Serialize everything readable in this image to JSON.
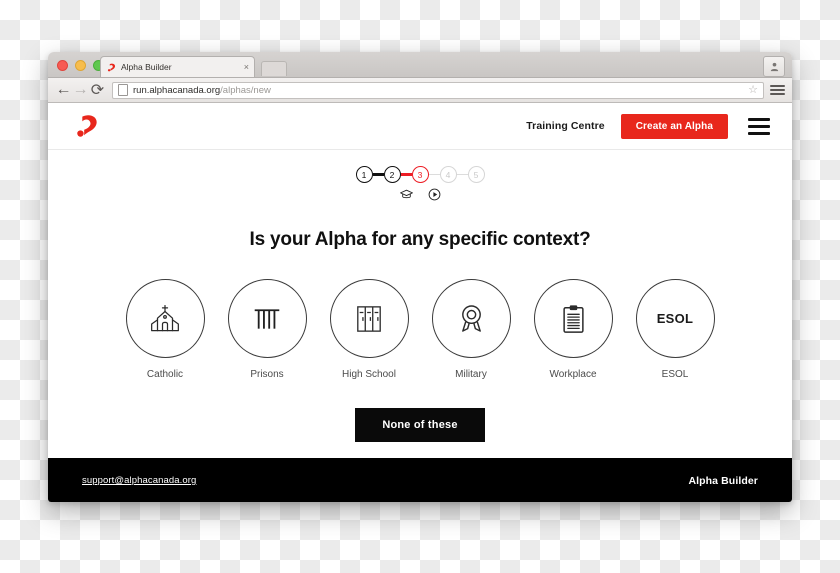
{
  "browser": {
    "tab": {
      "title": "Alpha Builder",
      "favicon": "alpha-logo-icon",
      "close_label": "×"
    },
    "newtab_label": "",
    "nav": {
      "back": "←",
      "forward": "→",
      "reload": "⟳"
    },
    "omnibox": {
      "url_host": "run.alphacanada.org",
      "url_path": "/alphas/new",
      "star": "☆"
    }
  },
  "header": {
    "logo_name": "alpha-logo",
    "training_centre": "Training Centre",
    "create_alpha": "Create an Alpha",
    "menu_name": "hamburger-menu"
  },
  "stepper": {
    "steps": [
      {
        "number": "1",
        "state": "complete",
        "icon": "graduation-cap-icon"
      },
      {
        "number": "2",
        "state": "complete",
        "icon": "play-circle-icon"
      },
      {
        "number": "3",
        "state": "active",
        "icon": ""
      },
      {
        "number": "4",
        "state": "upcoming",
        "icon": ""
      },
      {
        "number": "5",
        "state": "upcoming",
        "icon": ""
      }
    ]
  },
  "main": {
    "heading": "Is your Alpha for any specific context?",
    "options": [
      {
        "label": "Catholic",
        "icon": "church-icon"
      },
      {
        "label": "Prisons",
        "icon": "prison-bars-icon"
      },
      {
        "label": "High School",
        "icon": "lockers-icon"
      },
      {
        "label": "Military",
        "icon": "medal-icon"
      },
      {
        "label": "Workplace",
        "icon": "clipboard-icon"
      },
      {
        "label": "ESOL",
        "icon": "esol-text",
        "text": "ESOL"
      }
    ],
    "none_button": "None of these"
  },
  "footer": {
    "email": "support@alphacanada.org",
    "brand": "Alpha Builder"
  },
  "colors": {
    "accent_red": "#e8271c",
    "step_active_red": "#ed1c24",
    "black": "#000000"
  }
}
